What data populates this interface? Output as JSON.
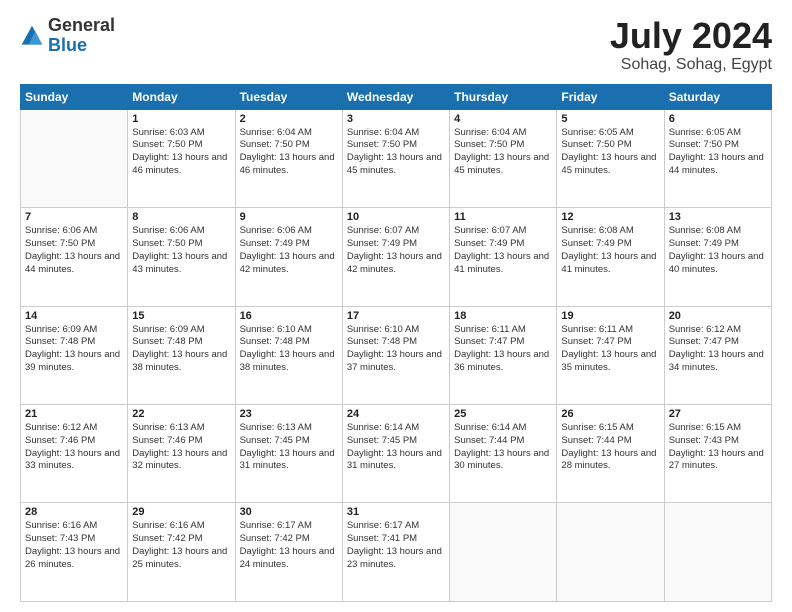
{
  "header": {
    "logo": {
      "general": "General",
      "blue": "Blue"
    },
    "title": "July 2024",
    "subtitle": "Sohag, Sohag, Egypt"
  },
  "weekdays": [
    "Sunday",
    "Monday",
    "Tuesday",
    "Wednesday",
    "Thursday",
    "Friday",
    "Saturday"
  ],
  "weeks": [
    [
      {
        "day": "",
        "text": ""
      },
      {
        "day": "1",
        "text": "Sunrise: 6:03 AM\nSunset: 7:50 PM\nDaylight: 13 hours and 46 minutes."
      },
      {
        "day": "2",
        "text": "Sunrise: 6:04 AM\nSunset: 7:50 PM\nDaylight: 13 hours and 46 minutes."
      },
      {
        "day": "3",
        "text": "Sunrise: 6:04 AM\nSunset: 7:50 PM\nDaylight: 13 hours and 45 minutes."
      },
      {
        "day": "4",
        "text": "Sunrise: 6:04 AM\nSunset: 7:50 PM\nDaylight: 13 hours and 45 minutes."
      },
      {
        "day": "5",
        "text": "Sunrise: 6:05 AM\nSunset: 7:50 PM\nDaylight: 13 hours and 45 minutes."
      },
      {
        "day": "6",
        "text": "Sunrise: 6:05 AM\nSunset: 7:50 PM\nDaylight: 13 hours and 44 minutes."
      }
    ],
    [
      {
        "day": "7",
        "text": "Sunrise: 6:06 AM\nSunset: 7:50 PM\nDaylight: 13 hours and 44 minutes."
      },
      {
        "day": "8",
        "text": "Sunrise: 6:06 AM\nSunset: 7:50 PM\nDaylight: 13 hours and 43 minutes."
      },
      {
        "day": "9",
        "text": "Sunrise: 6:06 AM\nSunset: 7:49 PM\nDaylight: 13 hours and 42 minutes."
      },
      {
        "day": "10",
        "text": "Sunrise: 6:07 AM\nSunset: 7:49 PM\nDaylight: 13 hours and 42 minutes."
      },
      {
        "day": "11",
        "text": "Sunrise: 6:07 AM\nSunset: 7:49 PM\nDaylight: 13 hours and 41 minutes."
      },
      {
        "day": "12",
        "text": "Sunrise: 6:08 AM\nSunset: 7:49 PM\nDaylight: 13 hours and 41 minutes."
      },
      {
        "day": "13",
        "text": "Sunrise: 6:08 AM\nSunset: 7:49 PM\nDaylight: 13 hours and 40 minutes."
      }
    ],
    [
      {
        "day": "14",
        "text": "Sunrise: 6:09 AM\nSunset: 7:48 PM\nDaylight: 13 hours and 39 minutes."
      },
      {
        "day": "15",
        "text": "Sunrise: 6:09 AM\nSunset: 7:48 PM\nDaylight: 13 hours and 38 minutes."
      },
      {
        "day": "16",
        "text": "Sunrise: 6:10 AM\nSunset: 7:48 PM\nDaylight: 13 hours and 38 minutes."
      },
      {
        "day": "17",
        "text": "Sunrise: 6:10 AM\nSunset: 7:48 PM\nDaylight: 13 hours and 37 minutes."
      },
      {
        "day": "18",
        "text": "Sunrise: 6:11 AM\nSunset: 7:47 PM\nDaylight: 13 hours and 36 minutes."
      },
      {
        "day": "19",
        "text": "Sunrise: 6:11 AM\nSunset: 7:47 PM\nDaylight: 13 hours and 35 minutes."
      },
      {
        "day": "20",
        "text": "Sunrise: 6:12 AM\nSunset: 7:47 PM\nDaylight: 13 hours and 34 minutes."
      }
    ],
    [
      {
        "day": "21",
        "text": "Sunrise: 6:12 AM\nSunset: 7:46 PM\nDaylight: 13 hours and 33 minutes."
      },
      {
        "day": "22",
        "text": "Sunrise: 6:13 AM\nSunset: 7:46 PM\nDaylight: 13 hours and 32 minutes."
      },
      {
        "day": "23",
        "text": "Sunrise: 6:13 AM\nSunset: 7:45 PM\nDaylight: 13 hours and 31 minutes."
      },
      {
        "day": "24",
        "text": "Sunrise: 6:14 AM\nSunset: 7:45 PM\nDaylight: 13 hours and 31 minutes."
      },
      {
        "day": "25",
        "text": "Sunrise: 6:14 AM\nSunset: 7:44 PM\nDaylight: 13 hours and 30 minutes."
      },
      {
        "day": "26",
        "text": "Sunrise: 6:15 AM\nSunset: 7:44 PM\nDaylight: 13 hours and 28 minutes."
      },
      {
        "day": "27",
        "text": "Sunrise: 6:15 AM\nSunset: 7:43 PM\nDaylight: 13 hours and 27 minutes."
      }
    ],
    [
      {
        "day": "28",
        "text": "Sunrise: 6:16 AM\nSunset: 7:43 PM\nDaylight: 13 hours and 26 minutes."
      },
      {
        "day": "29",
        "text": "Sunrise: 6:16 AM\nSunset: 7:42 PM\nDaylight: 13 hours and 25 minutes."
      },
      {
        "day": "30",
        "text": "Sunrise: 6:17 AM\nSunset: 7:42 PM\nDaylight: 13 hours and 24 minutes."
      },
      {
        "day": "31",
        "text": "Sunrise: 6:17 AM\nSunset: 7:41 PM\nDaylight: 13 hours and 23 minutes."
      },
      {
        "day": "",
        "text": ""
      },
      {
        "day": "",
        "text": ""
      },
      {
        "day": "",
        "text": ""
      }
    ]
  ]
}
